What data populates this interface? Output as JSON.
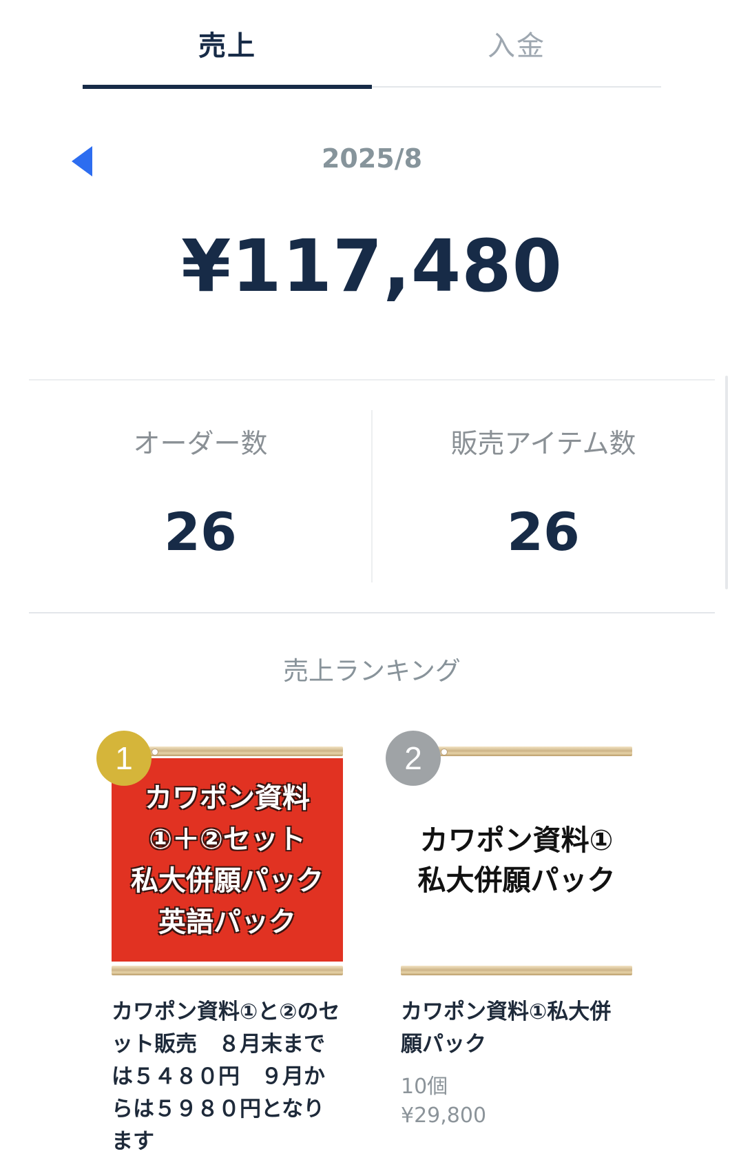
{
  "tabs": [
    {
      "label": "売上",
      "active": true
    },
    {
      "label": "入金",
      "active": false
    }
  ],
  "period": {
    "month": "2025/8",
    "prev_icon": "triangle-left-icon"
  },
  "sales": {
    "total": "¥117,480"
  },
  "stats": {
    "orders_label": "オーダー数",
    "orders_value": "26",
    "items_label": "販売アイテム数",
    "items_value": "26"
  },
  "ranking": {
    "title": "売上ランキング",
    "items": [
      {
        "rank": "1",
        "badge_color": "#d5b53a",
        "thumbnail_lines": [
          "カワポン資料",
          "①＋②セット",
          "私大併願パック",
          "英語パック"
        ],
        "thumbnail_bg": "#e13222",
        "name": "カワポン資料①と②のセット販売　８月末までは５４８０円　９月からは５９８０円となります"
      },
      {
        "rank": "2",
        "badge_color": "#9fa3a6",
        "thumbnail_lines": [
          "カワポン資料①",
          "私大併願パック"
        ],
        "thumbnail_bg": "#ffffff",
        "name": "カワポン資料①私大併願パック",
        "count": "10個",
        "price": "¥29,800"
      }
    ]
  },
  "colors": {
    "primary": "#172b47",
    "accent_blue": "#2d6df0",
    "muted": "#8a9095"
  }
}
